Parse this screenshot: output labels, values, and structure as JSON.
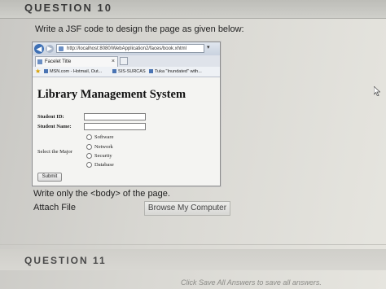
{
  "question": {
    "title": "QUESTION 10",
    "prompt": "Write a JSF code to design the page as given below:",
    "body_note": "Write only the <body> of the page.",
    "attach_label": "Attach File",
    "browse_button": "Browse My Computer"
  },
  "embedded_browser": {
    "address": "http://localhost:8080/WebApplication2/faces/book.xhtml",
    "tab_title": "Facelet Title",
    "tab_close": "×",
    "favorites": [
      "MSN.com - Hotmail, Out...",
      "SIS-SURCAS",
      "Tuka \"Inundated\" with..."
    ],
    "page_heading": "Library Management System",
    "student_id_label": "Student ID:",
    "student_name_label": "Student Name:",
    "select_major_label": "Select the Major",
    "majors": [
      "Software",
      "Network",
      "Security",
      "Database"
    ],
    "submit_label": "Submit"
  },
  "next_question": {
    "title": "QUESTION 11"
  },
  "footer": {
    "hint": "Click Save All Answers to save all answers."
  }
}
